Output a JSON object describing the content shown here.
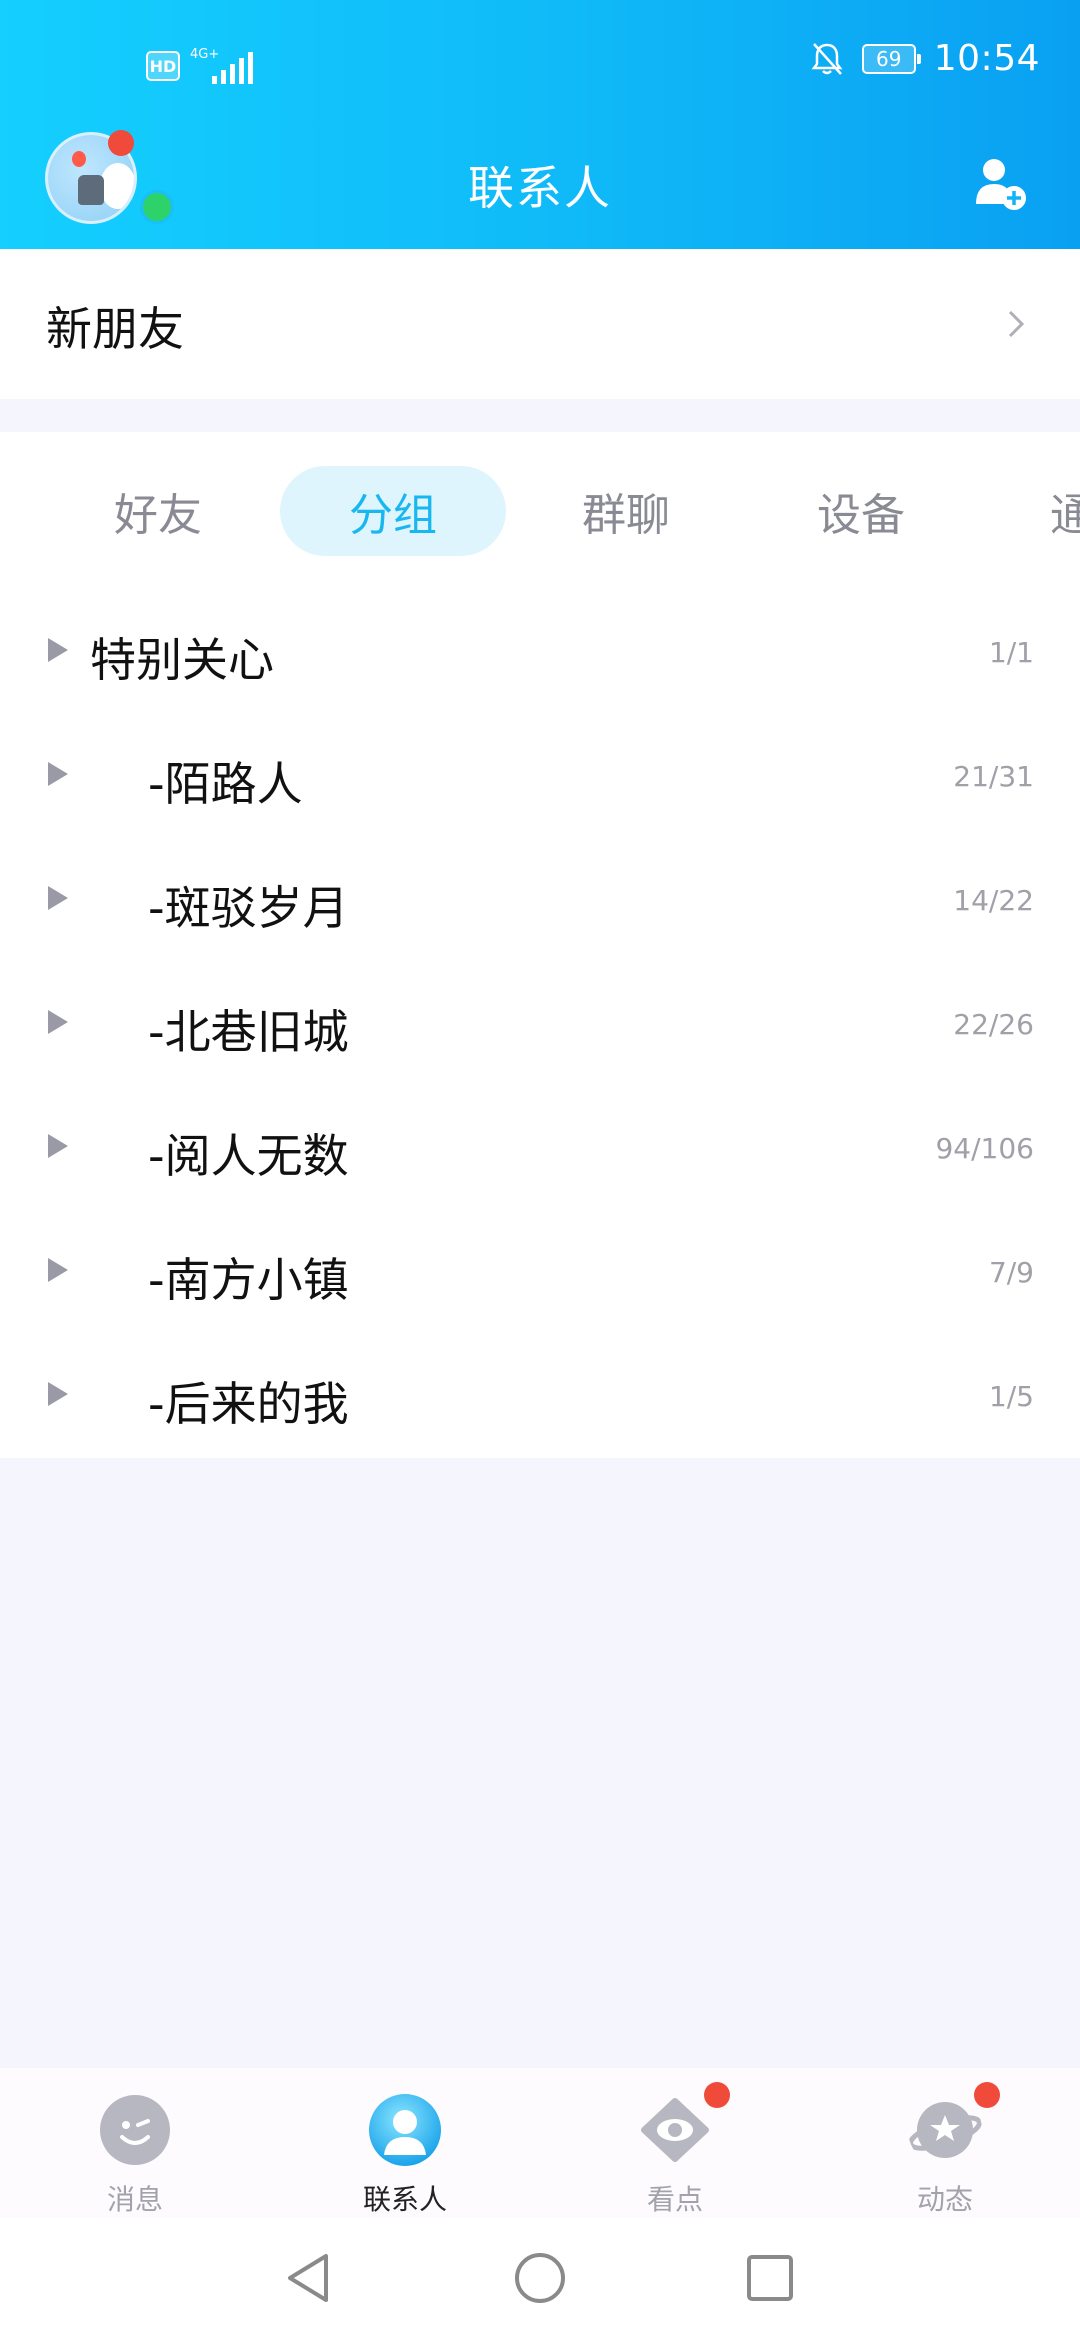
{
  "status_bar": {
    "hd_label": "HD",
    "network_label": "4G+",
    "battery_level": "69",
    "time": "10:54"
  },
  "header": {
    "title": "联系人"
  },
  "new_friends": {
    "label": "新朋友"
  },
  "tabs": [
    {
      "label": "好友",
      "active": false
    },
    {
      "label": "分组",
      "active": true
    },
    {
      "label": "群聊",
      "active": false
    },
    {
      "label": "设备",
      "active": false
    },
    {
      "label": "通",
      "active": false
    }
  ],
  "groups": [
    {
      "name": "特别关心",
      "count": "1/1"
    },
    {
      "name": "-陌路人",
      "count": "21/31"
    },
    {
      "name": "-斑驳岁月",
      "count": "14/22"
    },
    {
      "name": "-北巷旧城",
      "count": "22/26"
    },
    {
      "name": "-阅人无数",
      "count": "94/106"
    },
    {
      "name": "-南方小镇",
      "count": "7/9"
    },
    {
      "name": "-后来的我",
      "count": "1/5"
    }
  ],
  "bottom_nav": [
    {
      "label": "消息",
      "icon": "chat-icon",
      "active": false,
      "badge": false
    },
    {
      "label": "联系人",
      "icon": "contacts-icon",
      "active": true,
      "badge": false
    },
    {
      "label": "看点",
      "icon": "eye-icon",
      "active": false,
      "badge": true
    },
    {
      "label": "动态",
      "icon": "planet-icon",
      "active": false,
      "badge": true
    }
  ],
  "colors": {
    "accent": "#19b7f0",
    "header_gradient_start": "#14cfff",
    "header_gradient_end": "#0aa0f2",
    "badge": "#f04a3a"
  }
}
